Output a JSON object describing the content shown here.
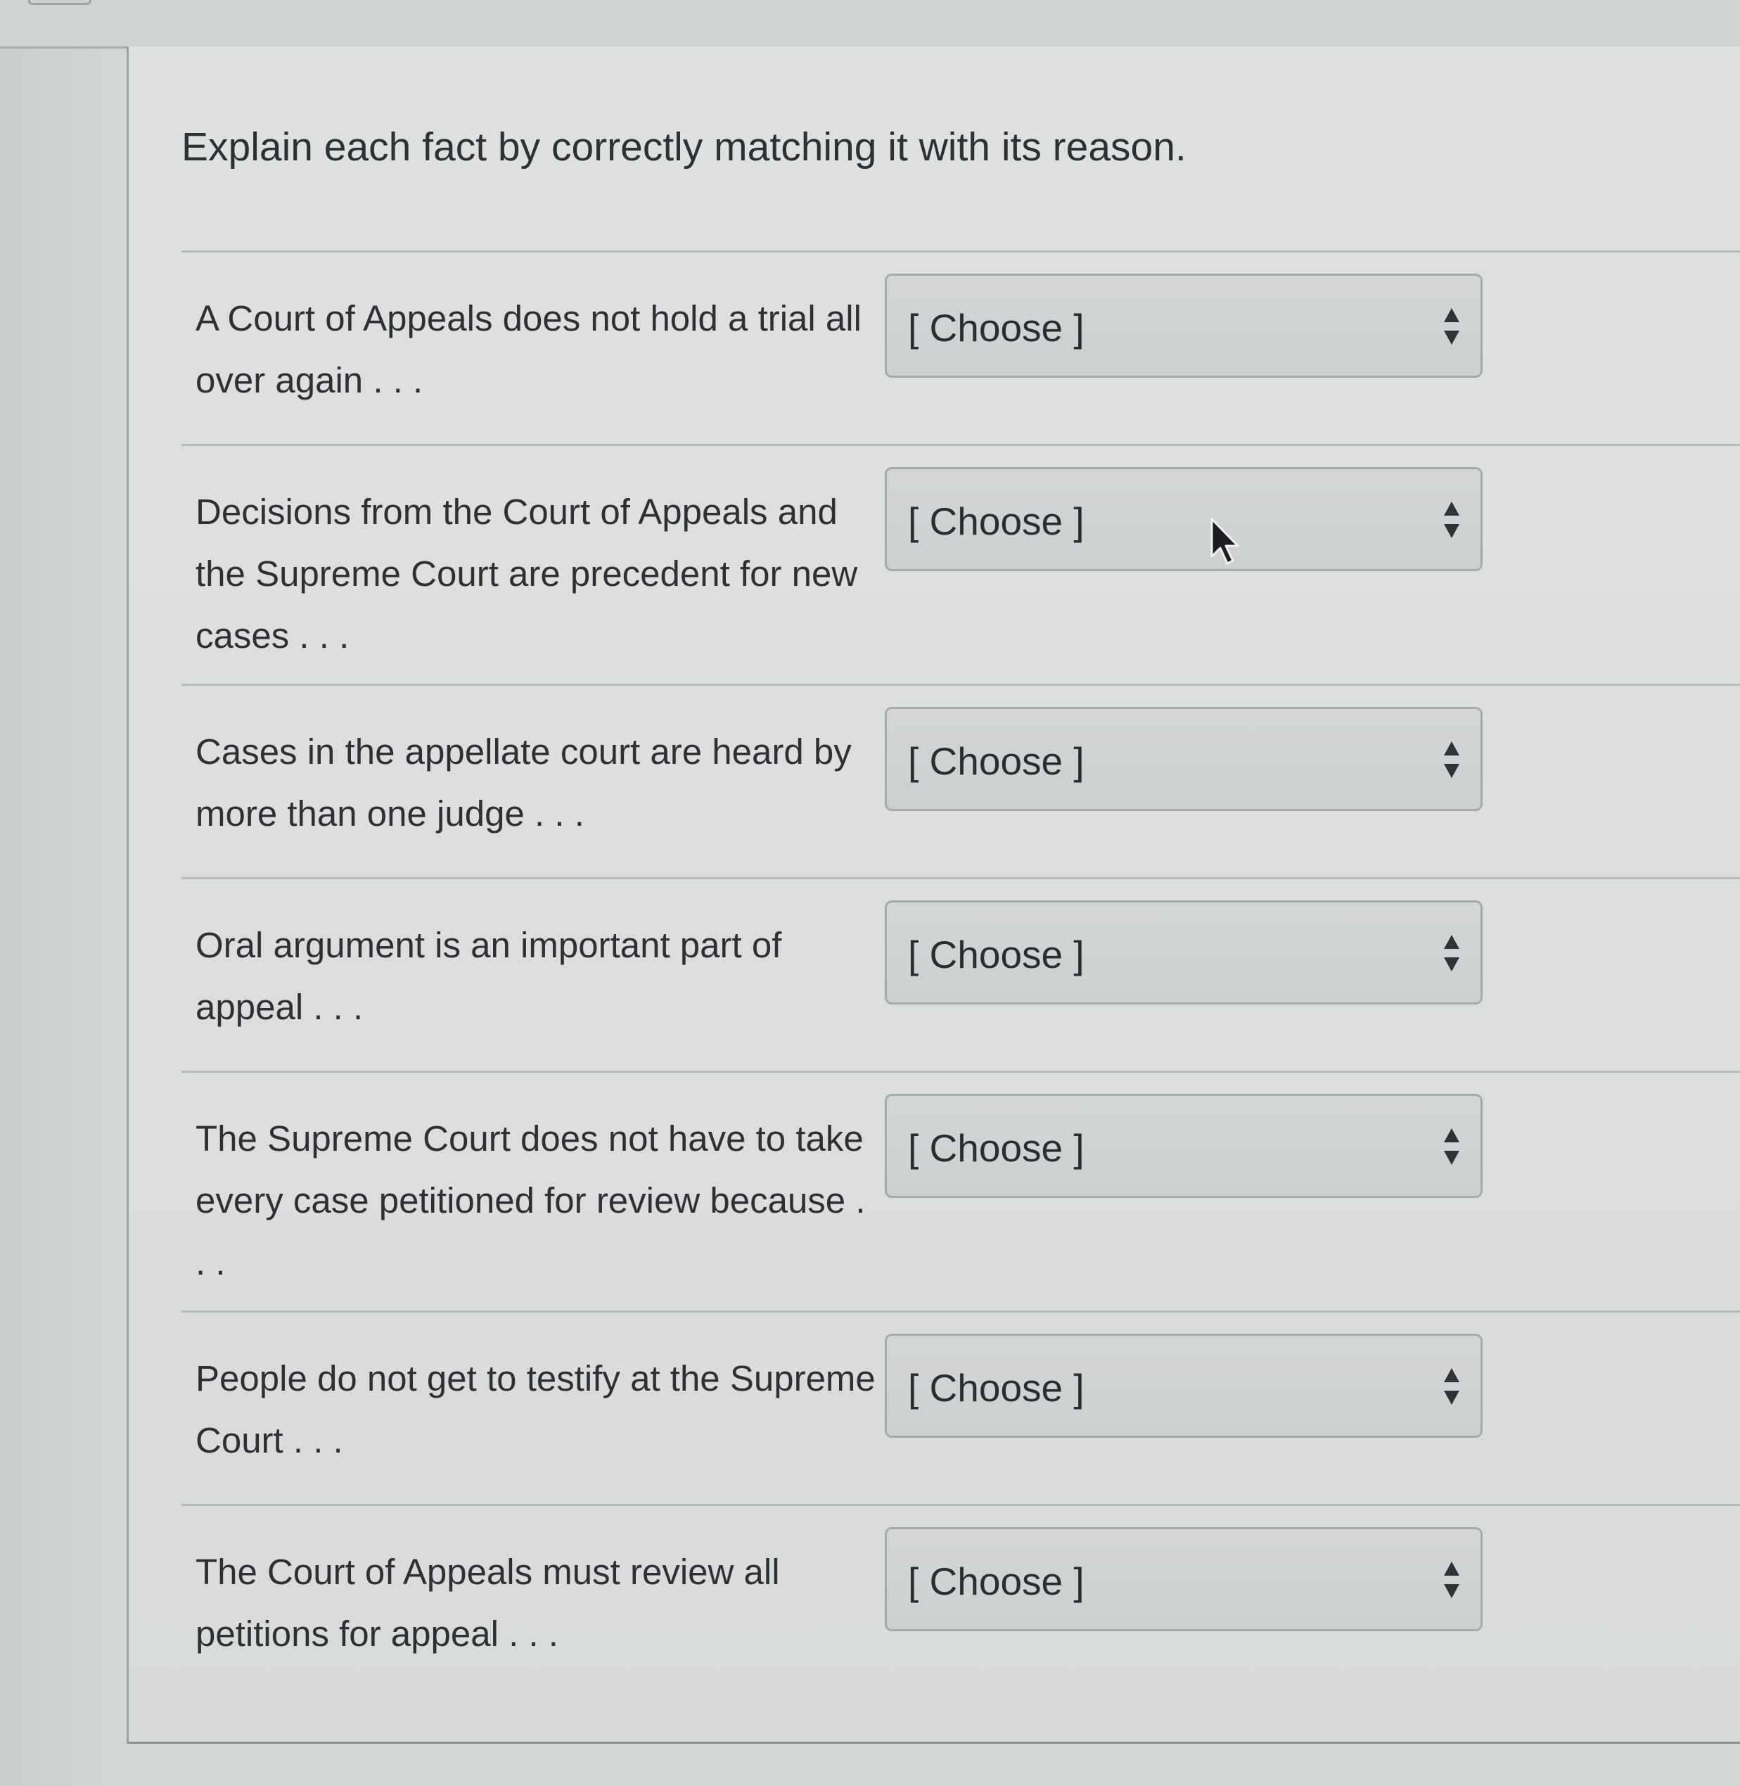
{
  "question": {
    "prompt": "Explain each fact by correctly matching it with its reason."
  },
  "rows": [
    {
      "fact": "A Court of Appeals does not hold a trial all over again . . .",
      "selected": "[ Choose ]"
    },
    {
      "fact": "Decisions from the Court of Appeals and the Supreme Court are precedent for new cases . . .",
      "selected": "[ Choose ]"
    },
    {
      "fact": "Cases in the appellate court are heard by more than one judge . . .",
      "selected": "[ Choose ]"
    },
    {
      "fact": "Oral argument is an important part of appeal . . .",
      "selected": "[ Choose ]"
    },
    {
      "fact": "The Supreme Court does not have to take every case petitioned for review because . . .",
      "selected": "[ Choose ]"
    },
    {
      "fact": "People do not get to testify at the Supreme Court . . .",
      "selected": "[ Choose ]"
    },
    {
      "fact": "The Court of Appeals must review all petitions for appeal . . .",
      "selected": "[ Choose ]"
    }
  ],
  "icons": {
    "select_arrows": "up-down-arrows-icon",
    "pointer": "mouse-pointer-icon"
  },
  "colors": {
    "background": "#dfe1e0",
    "text": "#2e3035",
    "select_fill": "#d0d2d2",
    "border": "#a7abab"
  }
}
